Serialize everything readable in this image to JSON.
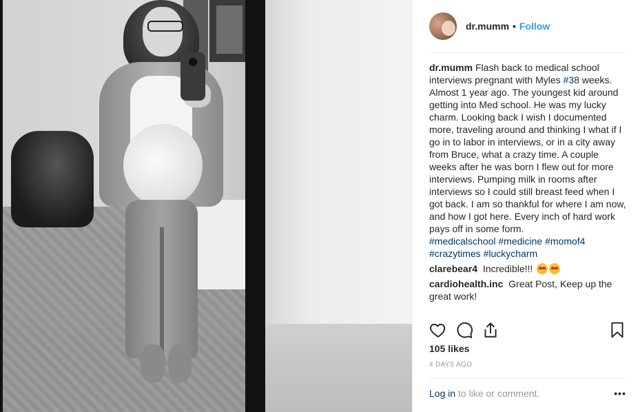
{
  "post": {
    "username": "dr.mumm",
    "follow_label": "Follow",
    "separator": "•"
  },
  "caption": {
    "username": "dr.mumm",
    "text_1": "Flash back to medical school interviews pregnant with Myles ",
    "tag_1": "#38",
    "text_2": " weeks. Almost 1 year ago. The youngest kid around getting into Med school. He was my lucky charm. Looking back I wish I documented more, traveling around and thinking I what if I go in to labor in interviews, or in a city away from Bruce, what a crazy time. A couple weeks after he was born I flew out for more interviews. Pumping milk in rooms after interviews so I could still breast feed when I got back. I am so thankful for where I am now, and how I got here. Every inch of hard work pays off in some form.",
    "hashtags": [
      "#medicalschool",
      "#medicine",
      "#momof4",
      "#crazytimes",
      "#luckycharm"
    ]
  },
  "comments": [
    {
      "user": "clarebear4",
      "text": "Incredible!!!",
      "emoji_count": 2
    },
    {
      "user": "cardiohealth.inc",
      "text": "Great Post, Keep up the great work!"
    }
  ],
  "stats": {
    "likes": "105 likes",
    "time": "4 DAYS AGO"
  },
  "footer": {
    "login": "Log in",
    "rest": " to like or comment.",
    "more": "•••"
  }
}
